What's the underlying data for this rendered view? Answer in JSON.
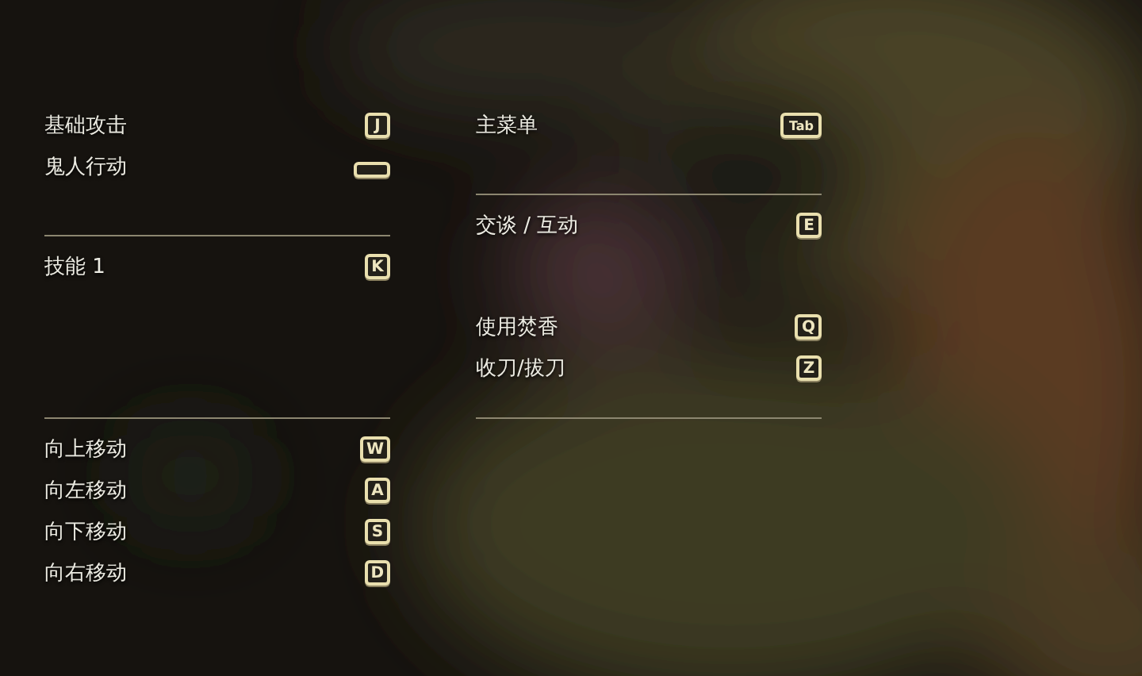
{
  "columns": [
    {
      "groups": [
        {
          "clusters": [
            [
              {
                "action": "基础攻击",
                "key": "J",
                "kind": "letter"
              },
              {
                "action": "鬼人行动",
                "kind": "space"
              }
            ]
          ]
        },
        {
          "clusters": [
            [
              {
                "action": "技能 1",
                "key": "K",
                "kind": "letter"
              }
            ]
          ]
        },
        {
          "clusters": [
            [
              {
                "action": "向上移动",
                "key": "W",
                "kind": "letter"
              },
              {
                "action": "向左移动",
                "key": "A",
                "kind": "letter"
              },
              {
                "action": "向下移动",
                "key": "S",
                "kind": "letter"
              },
              {
                "action": "向右移动",
                "key": "D",
                "kind": "letter"
              }
            ]
          ]
        }
      ]
    },
    {
      "groups": [
        {
          "clusters": [
            [
              {
                "action": "主菜单",
                "key": "Tab",
                "kind": "letter"
              }
            ]
          ]
        },
        {
          "clusters": [
            [
              {
                "action": "交谈 / 互动",
                "key": "E",
                "kind": "letter"
              }
            ],
            [
              {
                "action": "使用焚香",
                "key": "Q",
                "kind": "letter"
              },
              {
                "action": "收刀/拔刀",
                "key": "Z",
                "kind": "letter"
              }
            ]
          ]
        }
      ]
    }
  ]
}
